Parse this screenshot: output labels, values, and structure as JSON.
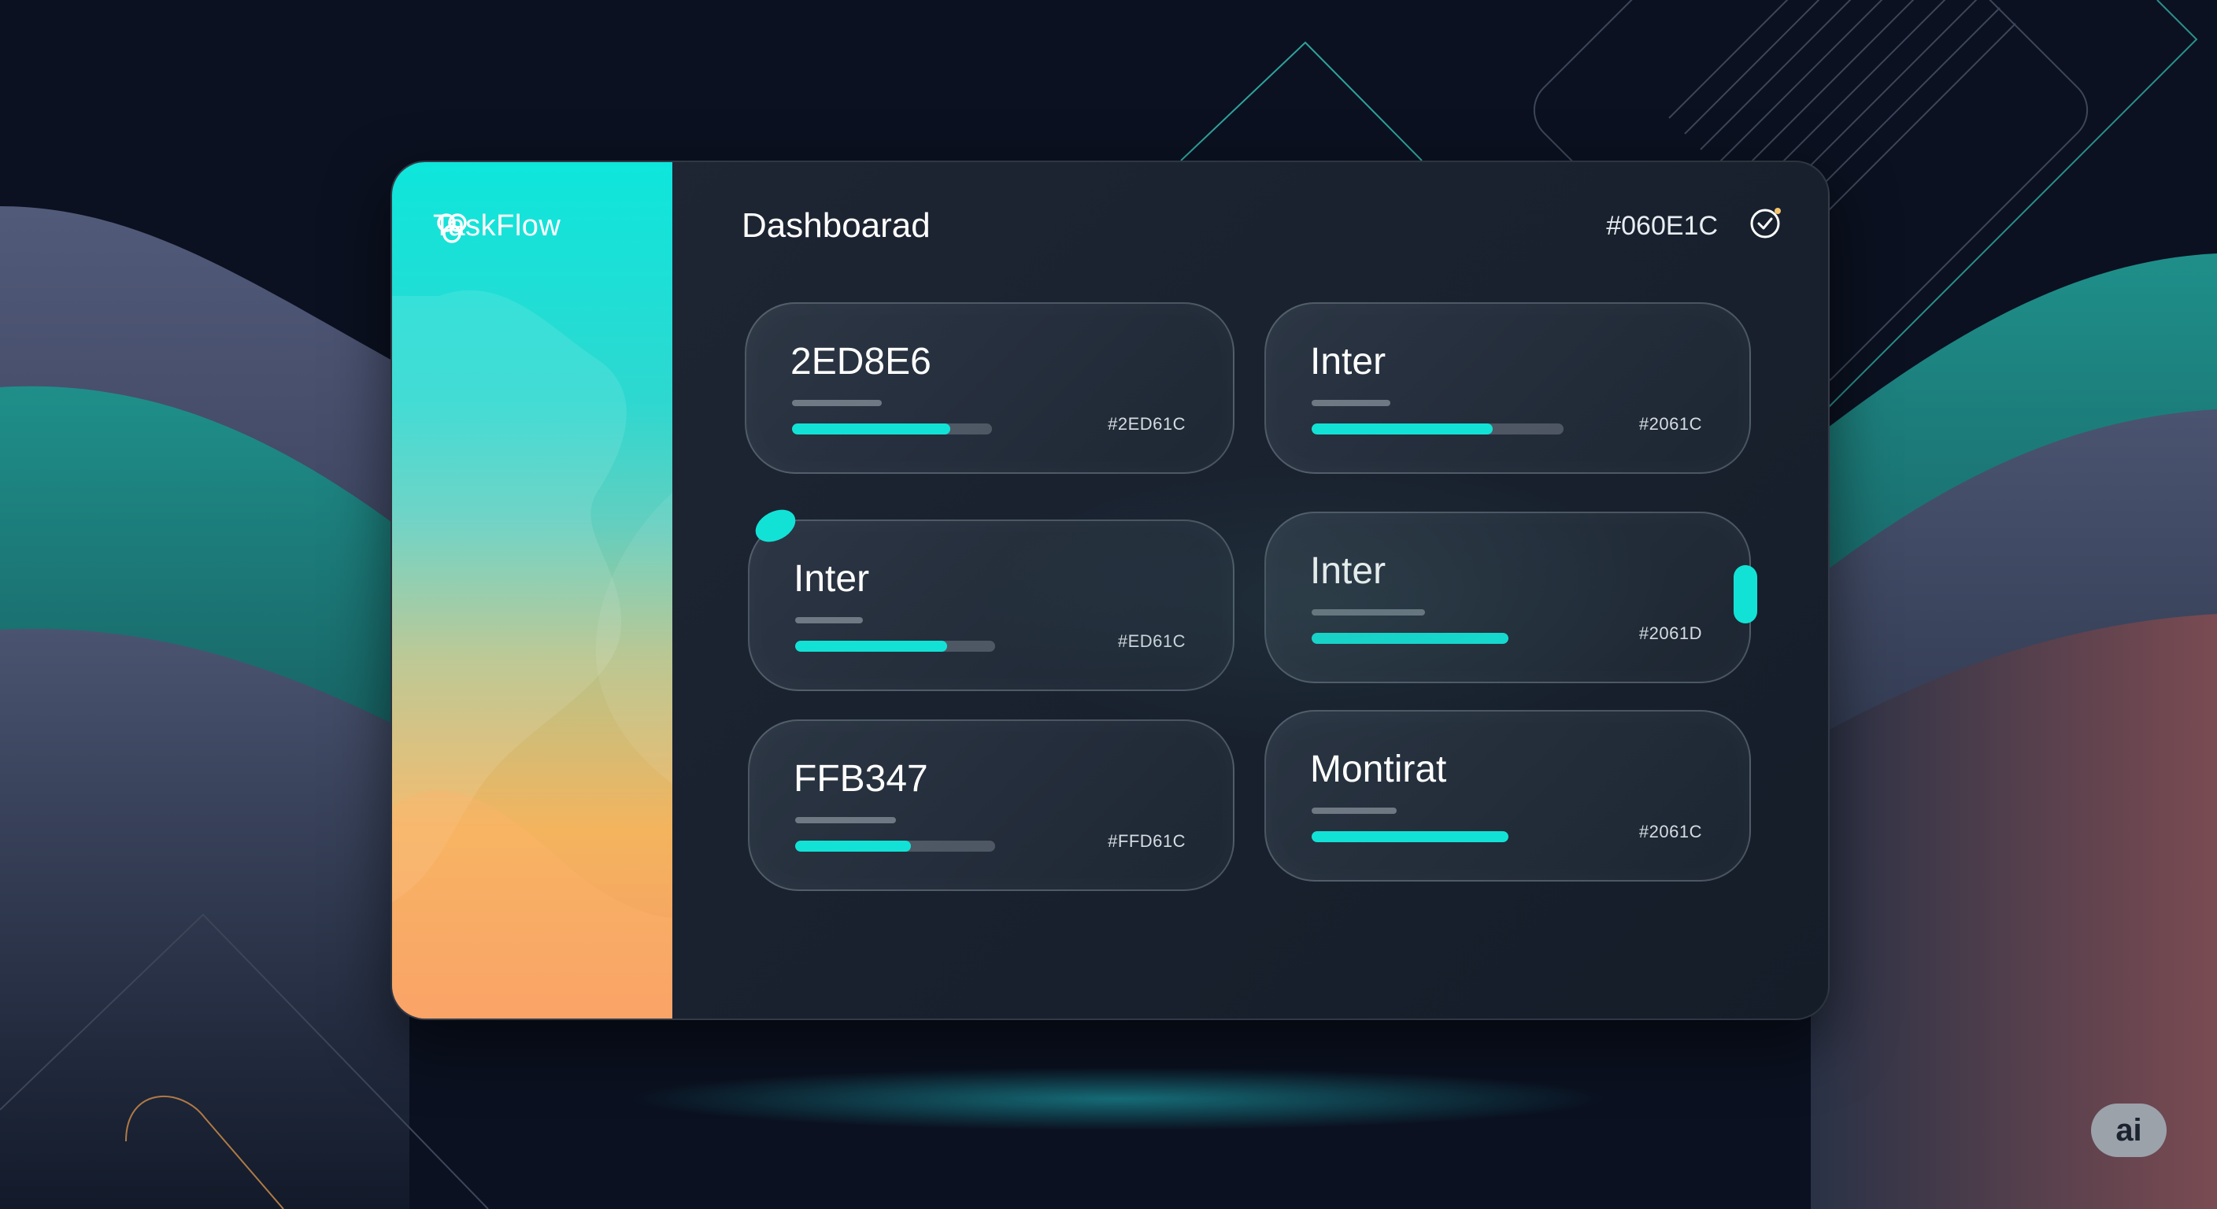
{
  "app": {
    "brand": "TaskFlow",
    "page_title": "Dashboarad",
    "header_hex": "#060E1C"
  },
  "icons": {
    "logo": "overlapping-circles-logo-icon",
    "header": "clock-check-icon"
  },
  "cards": [
    {
      "title": "2ED8E6",
      "code": "#2ED61C",
      "progress": 0.79
    },
    {
      "title": "Inter",
      "code": "#2061C",
      "progress": 0.72
    },
    {
      "title": "Inter",
      "code": "#ED61C",
      "progress": 0.76
    },
    {
      "title": "Inter",
      "code": "#2061D",
      "progress": 1.0
    },
    {
      "title": "FFB347",
      "code": "#FFD61C",
      "progress": 0.58
    },
    {
      "title": "Montirat",
      "code": "#2061C",
      "progress": 1.0
    }
  ],
  "badge": "ai",
  "colors": {
    "accent": "#12E2D6",
    "background": "#0B1120",
    "sidebar_top": "#0EE6DC",
    "sidebar_bottom": "#F79A66"
  }
}
